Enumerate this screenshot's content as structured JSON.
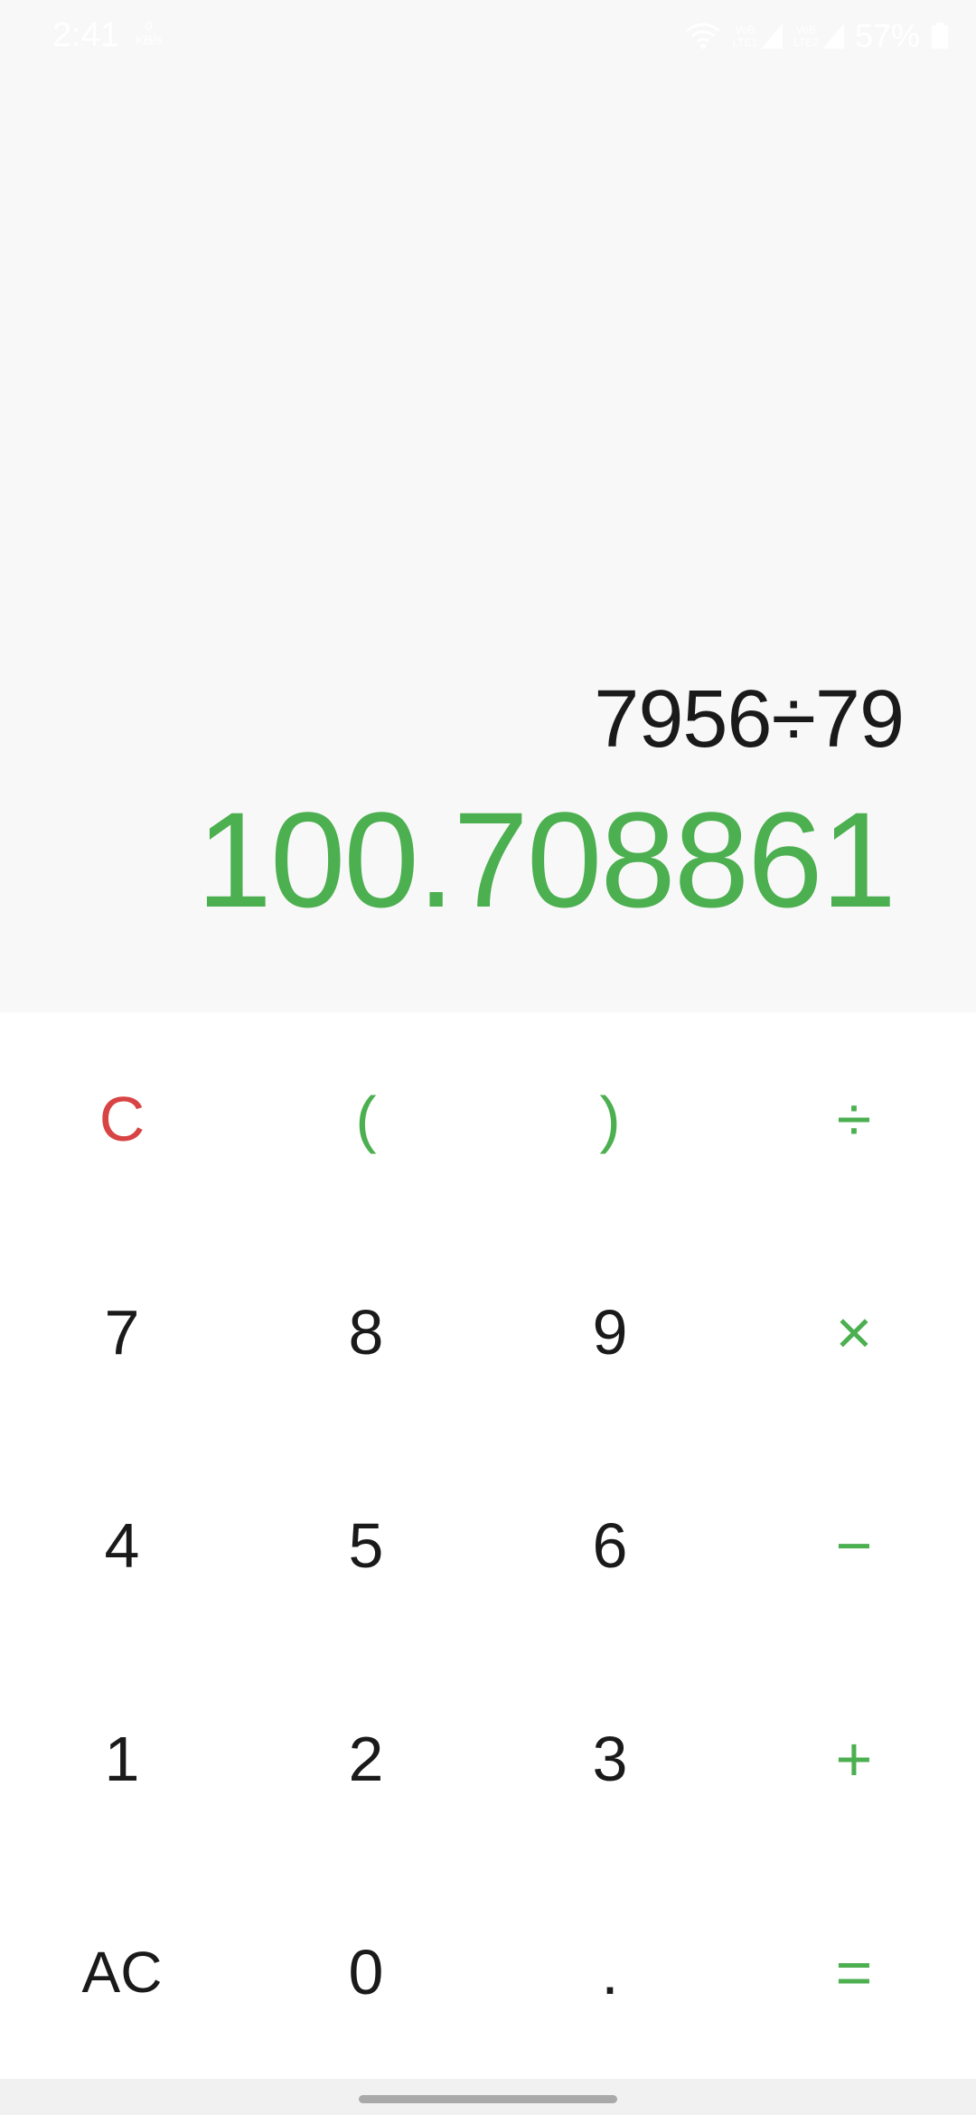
{
  "status_bar": {
    "time": "2:41",
    "data_speed_value": "0",
    "data_speed_unit": "KB/s",
    "sim1_label_top": "VoB",
    "sim1_label_bottom": "LTE1",
    "sim2_label_top": "VoB",
    "sim2_label_bottom": "LTE2",
    "battery_percent": "57%"
  },
  "display": {
    "expression": "7956÷79",
    "result": "100.708861"
  },
  "keypad": {
    "rows": [
      [
        "C",
        "(",
        ")",
        "÷"
      ],
      [
        "7",
        "8",
        "9",
        "×"
      ],
      [
        "4",
        "5",
        "6",
        "−"
      ],
      [
        "1",
        "2",
        "3",
        "+"
      ],
      [
        "AC",
        "0",
        ".",
        "="
      ]
    ]
  },
  "colors": {
    "accent": "#4caf50",
    "clear": "#d84343",
    "text": "#1a1a1a",
    "display_bg": "#f8f8f8",
    "keypad_bg": "#ffffff"
  }
}
